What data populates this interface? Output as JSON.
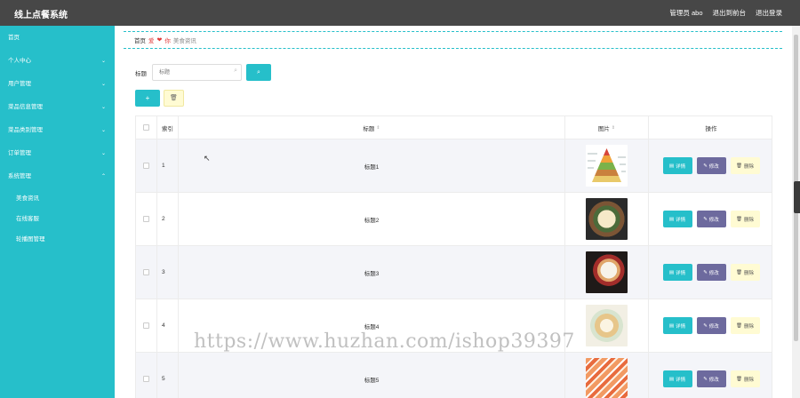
{
  "app": {
    "title": "线上点餐系统"
  },
  "topbar": {
    "user": "管理员 abo",
    "back": "退出到前台",
    "logout": "退出登录"
  },
  "sidebar": {
    "items": [
      {
        "label": "首页",
        "chevron": ""
      },
      {
        "label": "个人中心",
        "chevron": "⌄"
      },
      {
        "label": "用户管理",
        "chevron": "⌄"
      },
      {
        "label": "菜品信息管理",
        "chevron": "⌄"
      },
      {
        "label": "菜品类别管理",
        "chevron": "⌄"
      },
      {
        "label": "订单管理",
        "chevron": "⌄"
      },
      {
        "label": "系统管理",
        "chevron": "⌃"
      }
    ],
    "subitems": [
      {
        "label": "美食资讯"
      },
      {
        "label": "在线客服"
      },
      {
        "label": "轮播图管理"
      }
    ]
  },
  "breadcrumb": {
    "home": "首页",
    "mid_prefix": "爱",
    "heart": "❤",
    "mid_suffix": "你",
    "current": "美食资讯"
  },
  "search": {
    "label": "标题",
    "placeholder": "标题",
    "search_icon": "⌕"
  },
  "toolbar": {
    "add": "+",
    "delete_all": "🗑"
  },
  "table": {
    "headers": {
      "index": "索引",
      "title": "标题",
      "image": "图片",
      "ops": "操作",
      "sort_icon": "⇕"
    },
    "rows": [
      {
        "index": "1",
        "title": "标题1",
        "image": "food-pyramid"
      },
      {
        "index": "2",
        "title": "标题2",
        "image": "salad-plate"
      },
      {
        "index": "3",
        "title": "标题3",
        "image": "breakfast-plate"
      },
      {
        "index": "4",
        "title": "标题4",
        "image": "pastry-plate"
      },
      {
        "index": "5",
        "title": "标题5",
        "image": "sushi-platter"
      }
    ],
    "ops": {
      "detail": "详情",
      "detail_icon": "▤",
      "edit": "修改",
      "edit_icon": "✎",
      "delete": "删除",
      "delete_icon": "🗑"
    }
  },
  "watermark": "https://www.huzhan.com/ishop39397",
  "colors": {
    "accent": "#26bfca",
    "topbar": "#474747",
    "edit": "#6d6a9e",
    "delete": "#fffbd3"
  }
}
